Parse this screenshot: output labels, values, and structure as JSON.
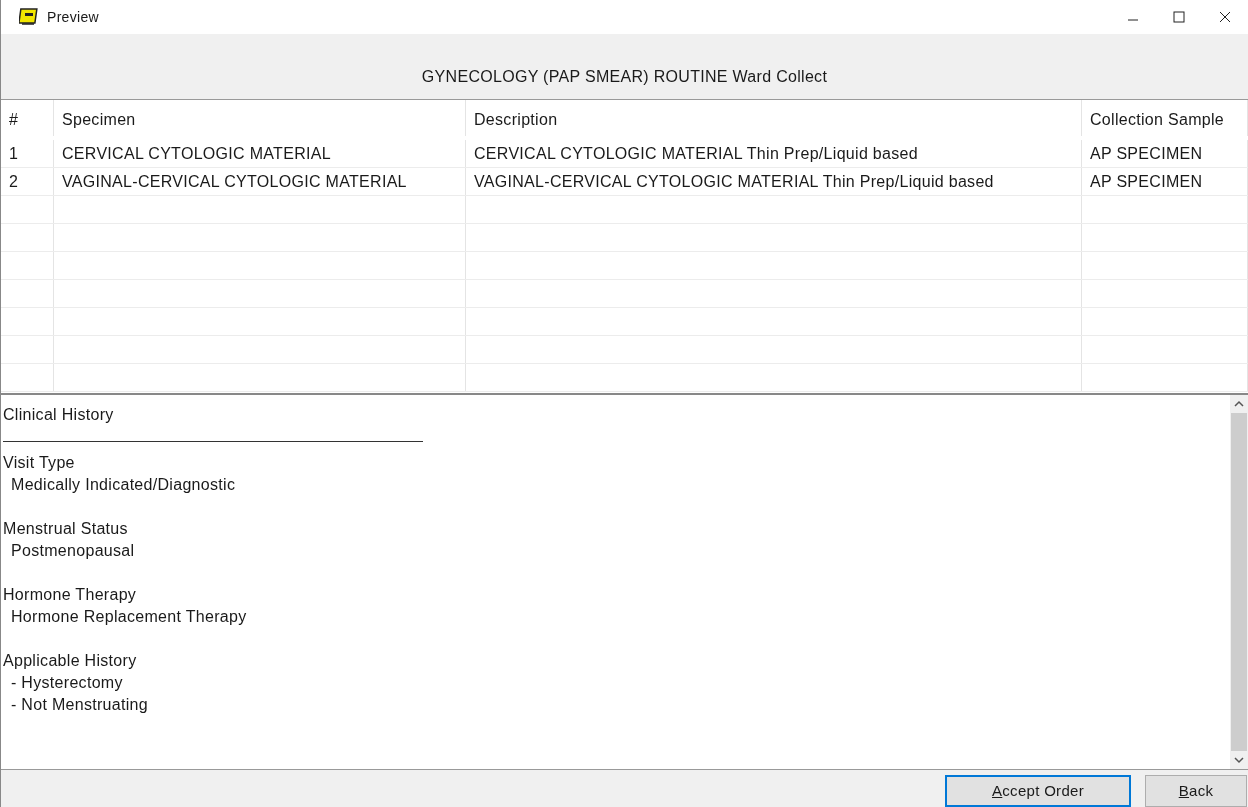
{
  "window": {
    "title": "Preview"
  },
  "header": "GYNECOLOGY (PAP SMEAR) ROUTINE Ward Collect",
  "table": {
    "columns": [
      "#",
      "Specimen",
      "Description",
      "Collection Sample"
    ],
    "rows": [
      [
        "1",
        "CERVICAL CYTOLOGIC MATERIAL",
        "CERVICAL CYTOLOGIC MATERIAL Thin Prep/Liquid based",
        "AP SPECIMEN"
      ],
      [
        "2",
        "VAGINAL-CERVICAL CYTOLOGIC MATERIAL",
        "VAGINAL-CERVICAL CYTOLOGIC MATERIAL Thin Prep/Liquid based",
        "AP SPECIMEN"
      ]
    ]
  },
  "clinical_history": {
    "title": "Clinical History",
    "sections": [
      {
        "heading": "Visit Type",
        "values": [
          "Medically Indicated/Diagnostic"
        ]
      },
      {
        "heading": "Menstrual Status",
        "values": [
          "Postmenopausal"
        ]
      },
      {
        "heading": "Hormone Therapy",
        "values": [
          "Hormone Replacement Therapy"
        ]
      },
      {
        "heading": "Applicable History",
        "values": [
          "- Hysterectomy",
          "- Not Menstruating"
        ]
      }
    ]
  },
  "buttons": [
    {
      "label": "Accept Order",
      "default": true
    },
    {
      "label": "Back",
      "default": false
    }
  ]
}
